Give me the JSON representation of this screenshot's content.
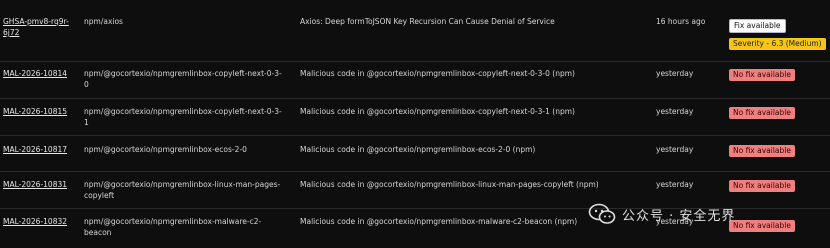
{
  "rows": [
    {
      "id": "GHSA-pmv8-rq9r-6j72",
      "package": "npm/axios",
      "description": "Axios: Deep formToJSON Key Recursion Can Cause Denial of Service",
      "time": "16 hours ago",
      "status": "Fix available",
      "severity": "Severity - 6.3 (Medium)"
    },
    {
      "id": "MAL-2026-10814",
      "package": "npm/@gocortexio/npmgremlinbox-copyleft-next-0-3-0",
      "description": "Malicious code in @gocortexio/npmgremlinbox-copyleft-next-0-3-0 (npm)",
      "time": "yesterday",
      "status": "No fix available"
    },
    {
      "id": "MAL-2026-10815",
      "package": "npm/@gocortexio/npmgremlinbox-copyleft-next-0-3-1",
      "description": "Malicious code in @gocortexio/npmgremlinbox-copyleft-next-0-3-1 (npm)",
      "time": "yesterday",
      "status": "No fix available"
    },
    {
      "id": "MAL-2026-10817",
      "package": "npm/@gocortexio/npmgremlinbox-ecos-2-0",
      "description": "Malicious code in @gocortexio/npmgremlinbox-ecos-2-0 (npm)",
      "time": "yesterday",
      "status": "No fix available"
    },
    {
      "id": "MAL-2026-10831",
      "package": "npm/@gocortexio/npmgremlinbox-linux-man-pages-copyleft",
      "description": "Malicious code in @gocortexio/npmgremlinbox-linux-man-pages-copyleft (npm)",
      "time": "yesterday",
      "status": "No fix available"
    },
    {
      "id": "MAL-2026-10832",
      "package": "npm/@gocortexio/npmgremlinbox-malware-c2-beacon",
      "description": "Malicious code in @gocortexio/npmgremlinbox-malware-c2-beacon (npm)",
      "time": "yesterday",
      "status": "No fix available"
    }
  ],
  "watermark": {
    "text": "公众号 · 安全无界",
    "icon": "wechat-icon"
  },
  "colors": {
    "background": "#0e0e0e",
    "fix": "#ffffff",
    "severity_medium": "#f5c518",
    "no_fix": "#f08080"
  }
}
